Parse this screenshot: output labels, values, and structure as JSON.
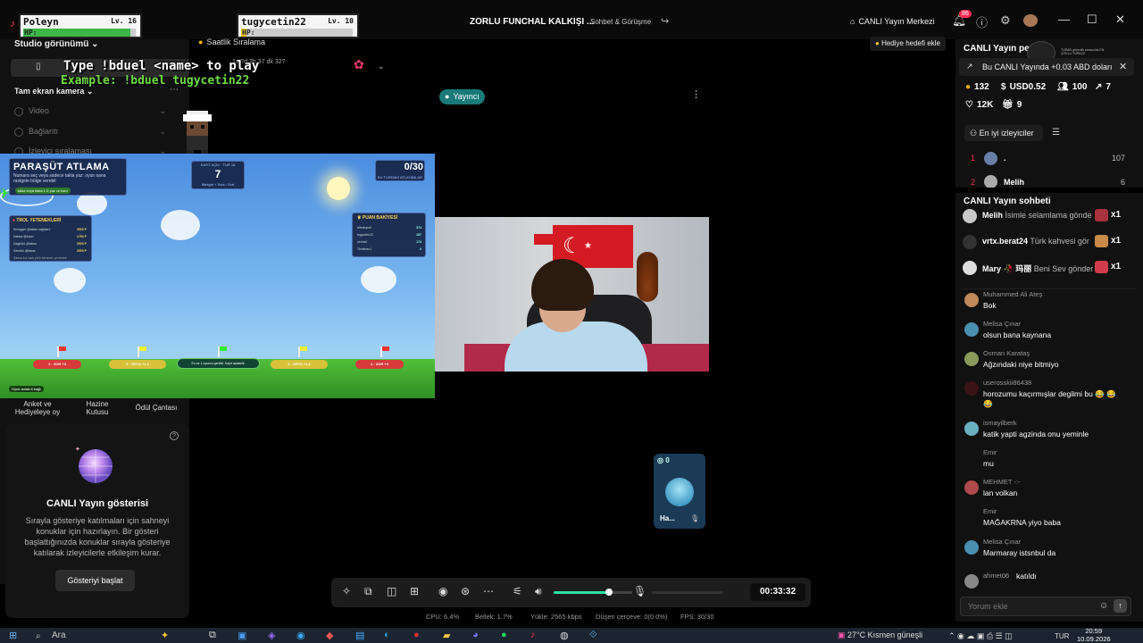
{
  "app": {
    "title": "ZORLU FUNCHAL KALKIŞI ...",
    "subtitle": "Sohbet & Görüşme",
    "live_center": "CANLI Yayın Merkezi",
    "notif_count": "86"
  },
  "players": [
    {
      "name": "Poleyn",
      "level": "Lv. 16",
      "hp_label": "HP:",
      "hp": 0.95,
      "hp_color": "#3cb648"
    },
    {
      "name": "tugycetin22",
      "level": "Lv. 10",
      "hp_label": "HP:",
      "hp": 0.05,
      "hp_color": "#e8c21f"
    }
  ],
  "left_panel": {
    "studio_view": "Studio görünümü",
    "ranking_tag": "Saatlik Sıralama",
    "mini_time": "1s 2d 3h 37 dk 32?",
    "full_screen": "Tam ekran kamera",
    "rows": [
      {
        "label": "Video"
      },
      {
        "label": "Bağlantı"
      },
      {
        "label": "İzleyici sıralaması"
      }
    ],
    "overlay_line1": "Type !bduel <name> to play",
    "overlay_line2": "Example: !bduel tugycetin22",
    "tools": [
      {
        "label": "Anket ve Hediyeleye oy"
      },
      {
        "label": "Hazine Kutusu"
      },
      {
        "label": "Ödül Çantası"
      }
    ],
    "showcase_title": "CANLI Yayın gösterisi",
    "showcase_text": "Sırayla gösteriye katılmaları için sahneyi konuklar için hazırlayın. Bir gösteri başlattığınızda konuklar sırayla gösteriye katılarak izleyicilerle etkileşim kurar.",
    "showcase_button": "Gösteriyi başlat"
  },
  "game": {
    "title": "PARAŞÜT ATLAMA",
    "desc": "Numara seç veya sadece takla yaz: oyun sana rastgele bölge verebil",
    "pill": "takla veya takla 1-5 yaz ve katıl",
    "reg_top": "KAYIT AÇIK · TUR 18",
    "reg_num": "7",
    "reg_bottom": "Bilnight + Sola / Sort",
    "count": "0/30",
    "count_sub": "BU TURDAKİ ATLAYANLAR",
    "troll_title": "TROL YETENEKLERİ",
    "troll_rows": [
      {
        "name": "Smogger @takas sağ/sarıl",
        "val": "3500 P"
      },
      {
        "name": "Habba @tolon",
        "val": "1750 P"
      },
      {
        "name": "Daghöld @takas",
        "val": "2500 P"
      },
      {
        "name": "Seneful @takas",
        "val": "2500 P"
      }
    ],
    "troll_foot": "Şansa kız kadı yürü ekrandır çevirmek",
    "points_title": "PUAN BAKİYESİ",
    "points_rows": [
      {
        "name": "altınkuprel",
        "val": "374"
      },
      {
        "name": "tugycetin22",
        "val": "157"
      },
      {
        "name": "seriusil",
        "val": "174"
      },
      {
        "name": "Tbwiman1",
        "val": "0"
      }
    ],
    "zones": [
      "1 · ZOR +3",
      "2 · ORTA +1.2",
      "3 · ORTA +1.2",
      "4 · ZOR +3"
    ],
    "mid_msg": "En az 1 oyuncu gerekli. Kayıt açılabilir.",
    "bottom_tag": "Oyuk anlatırıl bağlı"
  },
  "stage": {
    "host_label": "Yayıncı",
    "guest_count": "0",
    "guest_name": "Ha..."
  },
  "controls": {
    "timer": "00:33:32",
    "volume": 0.7
  },
  "stats": {
    "cpu": "CPU:  6.4%",
    "mem": "Bellek:  1.7%",
    "upload": "Yükle:  2565 kbps",
    "drop": "Düşen çerçeve:  0(0.0%)",
    "fps": "FPS:  30/30"
  },
  "right_panel": {
    "title": "CANLI Yayın pe",
    "logo_text": "TURAN güvenlik sonsuzluk EN ÇOKLU TÜRKÇE",
    "goal_button": "Hediye hedefi ekle",
    "earn_msg": "Bu CANLI Yayında +0.03 ABD doları",
    "stats": [
      {
        "icon": "coin",
        "value": "132"
      },
      {
        "icon": "dollar",
        "value": "USD0.52"
      },
      {
        "icon": "people",
        "value": "100"
      },
      {
        "icon": "share",
        "value": "7"
      },
      {
        "icon": "heart",
        "value": "12K"
      },
      {
        "icon": "gift",
        "value": "9"
      }
    ],
    "top_viewers_btn": "En iyi izleyiciler",
    "top_viewers": [
      {
        "rank": "1",
        "name": ".",
        "value": "107",
        "color": "#6a7fa8"
      },
      {
        "rank": "2",
        "name": "Melih",
        "value": "6",
        "color": "#aaa"
      }
    ],
    "chat_title": "CANLI Yayın sohbeti",
    "gifts": [
      {
        "user": "Melih",
        "text": "İsimle selamlama gönde",
        "count": "x1",
        "color": "#c9c9c9",
        "gift_color": "#a8323e"
      },
      {
        "user": "vrtx.berat24",
        "text": "Türk kahvesi gör",
        "count": "x1",
        "color": "#333",
        "gift_color": "#c98a4a"
      },
      {
        "user": "Mary 🥀 玛丽",
        "text": "Beni Sev gönder",
        "count": "x1",
        "color": "#ddd",
        "gift_color": "#d13c4a"
      }
    ],
    "messages": [
      {
        "user": "Muhammed Ali Ateş",
        "text": "Bok",
        "color": "#c08a5a"
      },
      {
        "user": "Melisa Çınar",
        "text": "olsun bana kaynana",
        "color": "#4a8fb0"
      },
      {
        "user": "Osman Karataş",
        "text": "Ağzındaki niye bitmiyo",
        "color": "#8a9a5a"
      },
      {
        "user": "userosskii86438",
        "text": "horozumu kaçırmışlar degilmi bu 😂 😂 😂",
        "color": "#3a1414"
      },
      {
        "user": "ismayilberk",
        "text": "katik yapti agzinda onu yeminle",
        "color": "#6ab0c0"
      },
      {
        "user": "Emir",
        "text": "mu",
        "color": "#111"
      },
      {
        "user": "MEHMET -:-",
        "text": "lan volkan",
        "color": "#b04a4a"
      },
      {
        "user": "Emir",
        "text": "MAĞAKRNA yiyo baba",
        "color": "#111"
      },
      {
        "user": "Melisa Çınar",
        "text": "Marmaray istsnbul da",
        "color": "#4a8fb0"
      },
      {
        "user": "ahmet06",
        "text": "katıldı",
        "color": "#888"
      }
    ],
    "input_placeholder": "Yorum ekle"
  },
  "taskbar": {
    "search": "Ara",
    "weather": "27°C  Kısmen güneşli",
    "lang": "TUR",
    "time": "20:59",
    "date": "10.09.2026"
  }
}
